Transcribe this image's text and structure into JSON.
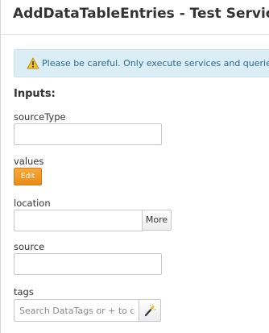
{
  "header": {
    "title": "AddDataTableEntries - Test Service"
  },
  "warning": {
    "icon": "warning-icon",
    "text": "Please be careful. Only execute services and queries w"
  },
  "inputs": {
    "heading": "Inputs:",
    "source_type": {
      "label": "sourceType",
      "value": ""
    },
    "values": {
      "label": "values",
      "button_label": "Edit"
    },
    "location": {
      "label": "location",
      "value": "",
      "button_label": "More"
    },
    "source": {
      "label": "source",
      "value": ""
    },
    "tags": {
      "label": "tags",
      "placeholder": "Search DataTags or + to cr",
      "button_icon": "magic-wand-icon"
    }
  },
  "colors": {
    "edit_button": "#f39a25",
    "warning_bg": "#dbeef6",
    "warning_text": "#2a6a8a"
  }
}
